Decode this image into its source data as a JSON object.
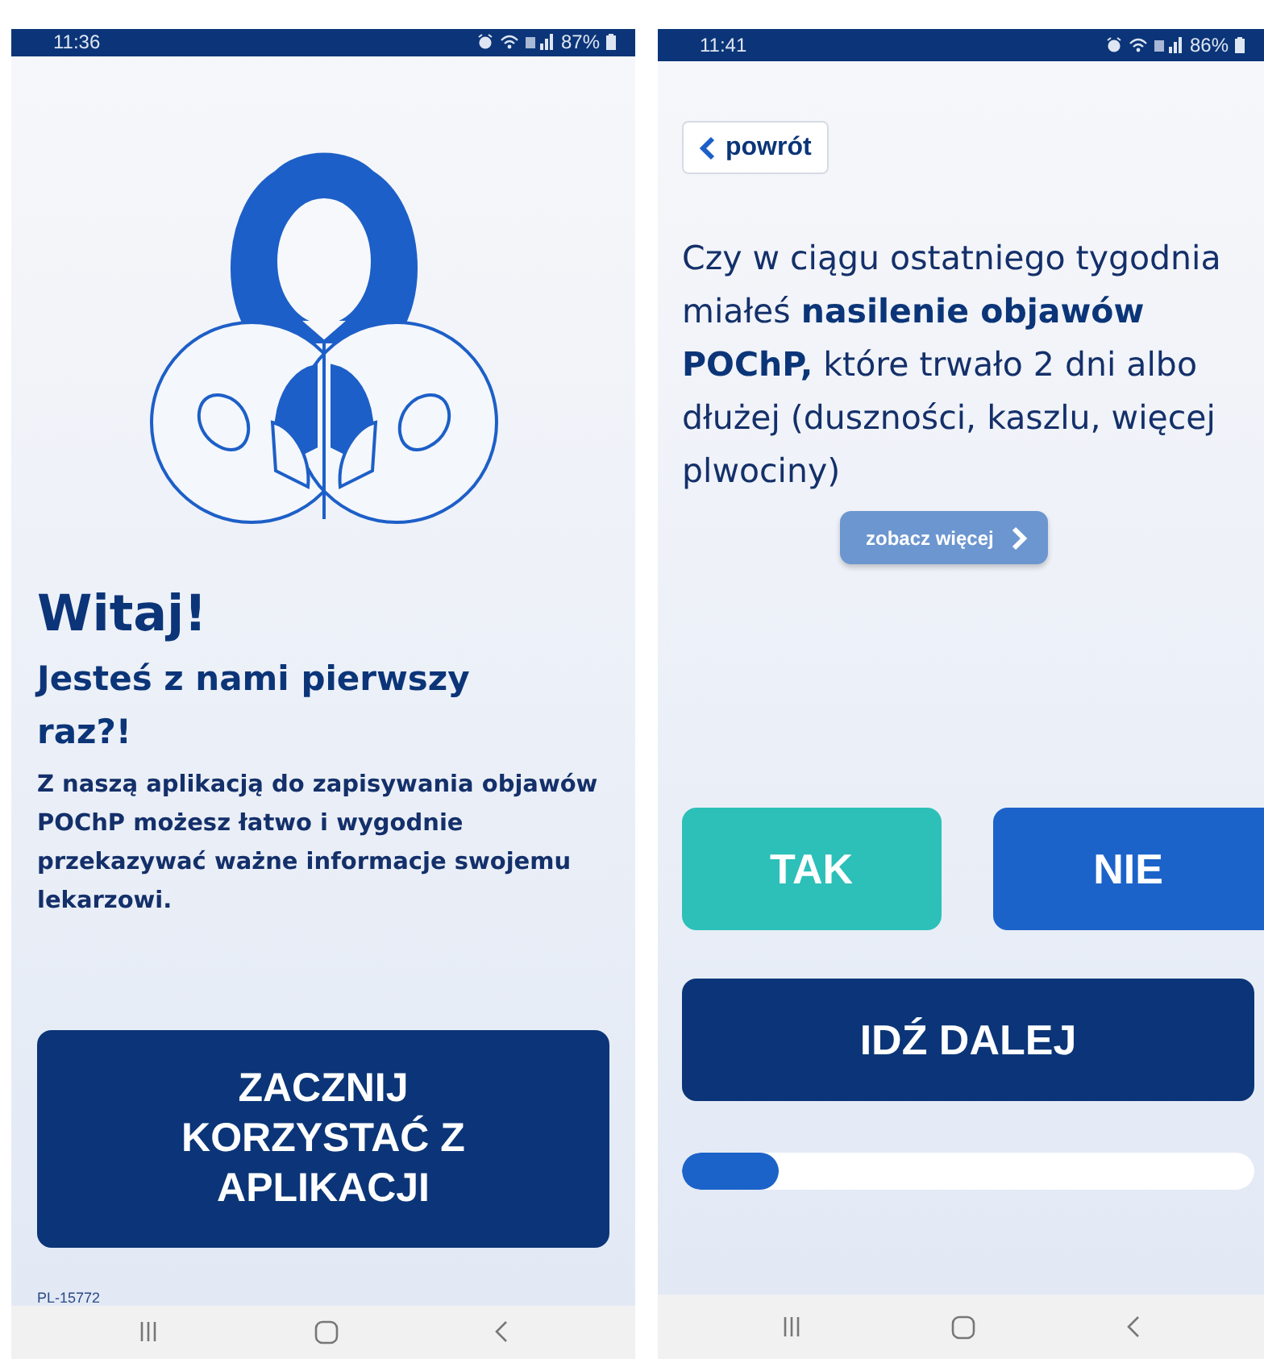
{
  "welcome_screen": {
    "status_bar": {
      "time": "11:36",
      "battery": "87%"
    },
    "title": "Witaj!",
    "subtitle": "Jesteś z nami pierwszy raz?!",
    "body": "Z naszą aplikacją do zapisywania objawów POChP możesz łatwo i wygodnie przekazywać ważne informacje swojemu lekarzowi.",
    "start_button": "ZACZNIJ KORZYSTAĆ Z APLIKACJI",
    "code": "PL-15772"
  },
  "question_screen": {
    "status_bar": {
      "time": "11:41",
      "battery": "86%"
    },
    "back_button": "powrót",
    "question": "Czy w ciągu ostatniego tygodnia miałeś **nasilenie objawów POChP,** które trwało 2 dni albo dłużej (duszności, kaszlu, więcej plwociny)",
    "more_button": "zobacz więcej",
    "answers": [
      {
        "label": "TAK",
        "color": "#2cc0b9"
      },
      {
        "label": "NIE",
        "color": "#1c63c9"
      }
    ],
    "next_button": "IDŹ DALEJ",
    "progress": {
      "level": 0.17
    }
  }
}
